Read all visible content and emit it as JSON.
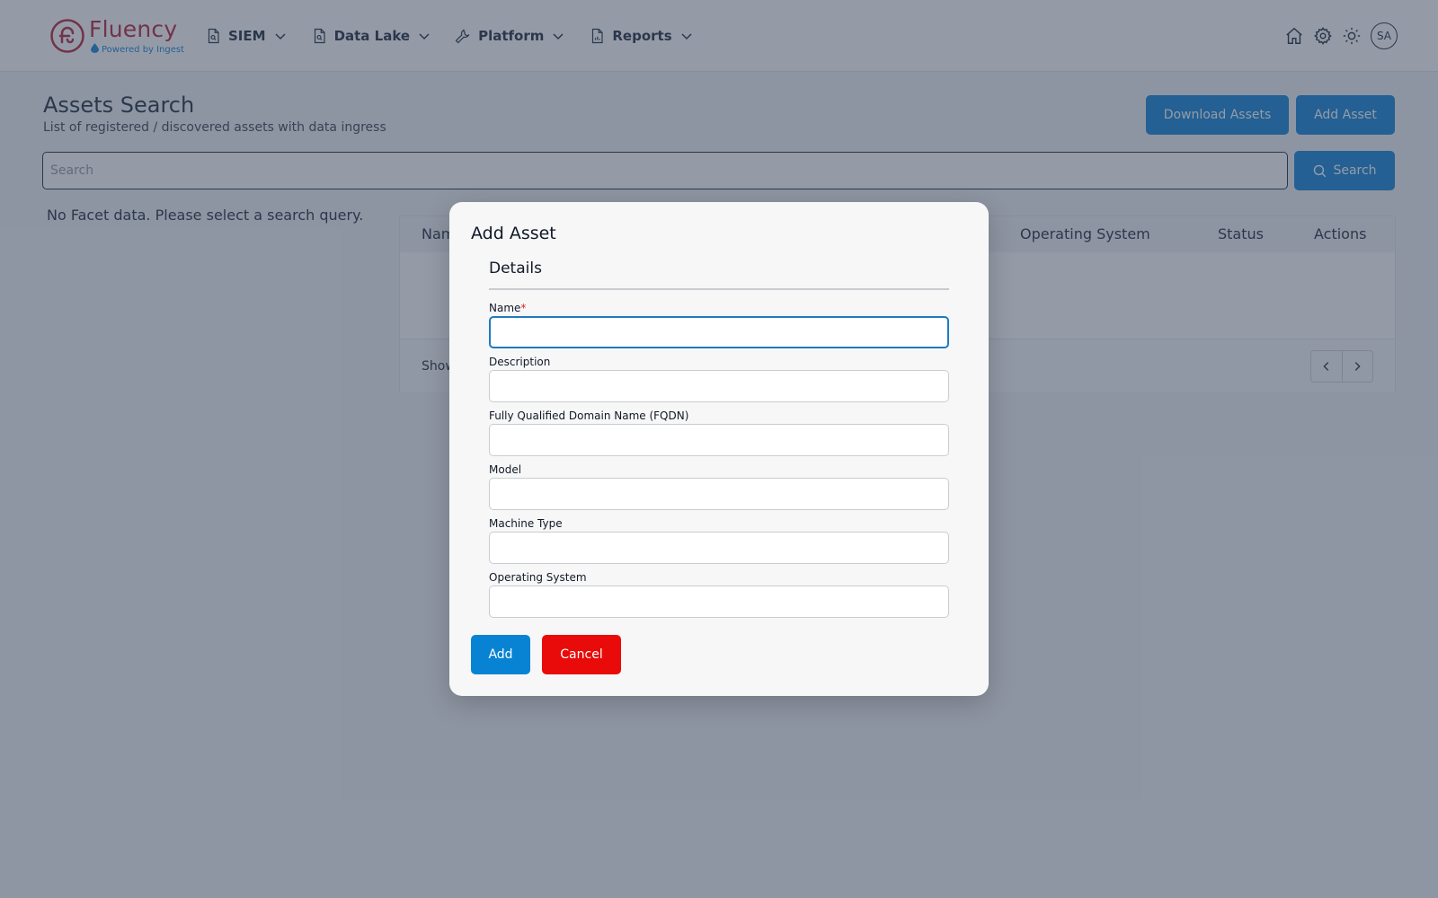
{
  "header": {
    "logo": {
      "text": "Fluency",
      "subtitle": "Powered by Ingest"
    },
    "nav": [
      {
        "label": "SIEM",
        "icon": "document-search-icon"
      },
      {
        "label": "Data Lake",
        "icon": "document-search-icon"
      },
      {
        "label": "Platform",
        "icon": "wrench-icon"
      },
      {
        "label": "Reports",
        "icon": "document-chart-icon"
      }
    ],
    "right_icons": [
      "home-icon",
      "gear-icon",
      "sun-icon"
    ],
    "avatar_initials": "SA"
  },
  "page": {
    "title": "Assets Search",
    "subtitle": "List of registered / discovered assets with data ingress",
    "download_label": "Download Assets",
    "add_asset_label": "Add Asset",
    "search_placeholder": "Search",
    "search_button_label": "Search",
    "no_facet_text": "No Facet data. Please select a search query."
  },
  "table": {
    "columns": [
      "Nam",
      "Operating System",
      "Status",
      "Actions"
    ],
    "footer_text": "Show"
  },
  "modal": {
    "title": "Add Asset",
    "section_title": "Details",
    "fields": [
      {
        "label": "Name",
        "required_mark": "*",
        "value": ""
      },
      {
        "label": "Description",
        "value": ""
      },
      {
        "label": "Fully Qualified Domain Name (FQDN)",
        "value": ""
      },
      {
        "label": "Model",
        "value": ""
      },
      {
        "label": "Machine Type",
        "value": ""
      },
      {
        "label": "Operating System",
        "value": ""
      }
    ],
    "add_label": "Add",
    "cancel_label": "Cancel"
  },
  "colors": {
    "brand": "#c0394c",
    "primary": "#0883d3",
    "danger": "#e90a0a",
    "overlay": "#1f2d48"
  }
}
